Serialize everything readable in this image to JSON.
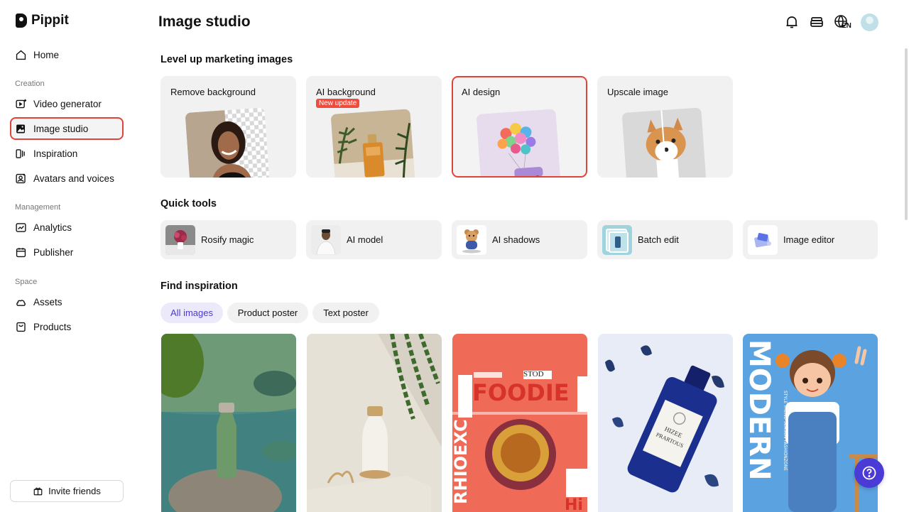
{
  "app": {
    "name": "Pippit"
  },
  "sidebar": {
    "home": "Home",
    "creation_label": "Creation",
    "video_generator": "Video generator",
    "image_studio": "Image studio",
    "inspiration": "Inspiration",
    "avatars": "Avatars and voices",
    "management_label": "Management",
    "analytics": "Analytics",
    "publisher": "Publisher",
    "space_label": "Space",
    "assets": "Assets",
    "products": "Products",
    "invite": "Invite friends"
  },
  "header": {
    "title": "Image studio",
    "lang": "EN"
  },
  "marketing": {
    "heading": "Level up marketing images",
    "cards": [
      {
        "title": "Remove background"
      },
      {
        "title": "AI background",
        "badge": "New update"
      },
      {
        "title": "AI design"
      },
      {
        "title": "Upscale image"
      }
    ]
  },
  "quick_tools": {
    "heading": "Quick tools",
    "items": [
      {
        "label": "Rosify magic"
      },
      {
        "label": "AI model"
      },
      {
        "label": "AI shadows"
      },
      {
        "label": "Batch edit"
      },
      {
        "label": "Image editor"
      }
    ]
  },
  "inspiration": {
    "heading": "Find inspiration",
    "filters": [
      "All images",
      "Product poster",
      "Text poster"
    ],
    "gallery": {
      "foodie_title": "FOODIE",
      "foodie_side": "RHIOEXC",
      "foodie_hi": "Hi",
      "foodie_stod": "STOD",
      "perfume_brand": "HIZEE",
      "perfume_sub": "PRARTOUS",
      "modern_title": "MODERN",
      "modern_sub": "STYLE TREND SEASON FASHIONZONE"
    }
  },
  "colors": {
    "accent_red": "#e0433a",
    "accent_purple": "#4a3ad6",
    "chip_active_bg": "#ece9fb"
  }
}
